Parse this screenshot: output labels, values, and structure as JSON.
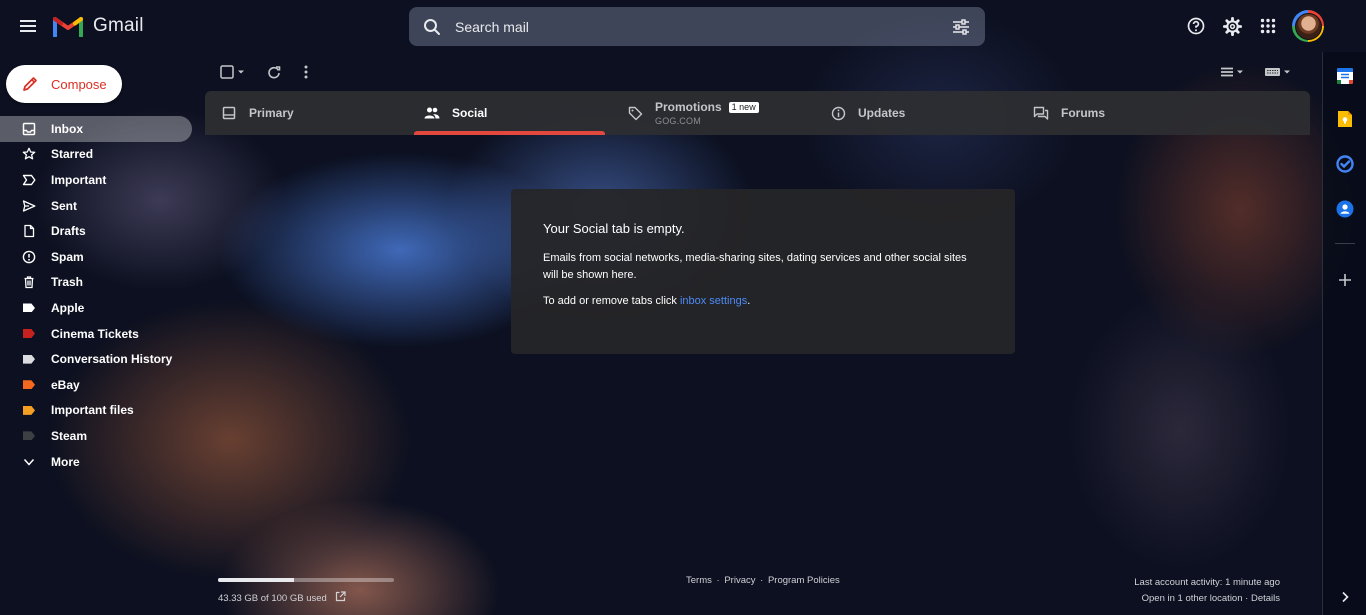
{
  "app": {
    "name": "Gmail"
  },
  "search": {
    "placeholder": "Search mail"
  },
  "compose": {
    "label": "Compose"
  },
  "sidebar": {
    "items": [
      {
        "label": "Inbox",
        "icon": "inbox-icon",
        "active": true
      },
      {
        "label": "Starred",
        "icon": "star-icon"
      },
      {
        "label": "Important",
        "icon": "important-icon"
      },
      {
        "label": "Sent",
        "icon": "send-icon"
      },
      {
        "label": "Drafts",
        "icon": "draft-icon"
      },
      {
        "label": "Spam",
        "icon": "spam-icon"
      },
      {
        "label": "Trash",
        "icon": "trash-icon"
      },
      {
        "label": "Apple",
        "icon": "label-icon",
        "color": "#ffffff"
      },
      {
        "label": "Cinema Tickets",
        "icon": "label-icon",
        "color": "#c5221f"
      },
      {
        "label": "Conversation History",
        "icon": "label-icon",
        "color": "#dadce0"
      },
      {
        "label": "eBay",
        "icon": "label-icon",
        "color": "#f5691f"
      },
      {
        "label": "Important files",
        "icon": "label-icon",
        "color": "#f59e24"
      },
      {
        "label": "Steam",
        "icon": "label-icon",
        "color": "#3c4043"
      },
      {
        "label": "More",
        "icon": "chevron-down-icon"
      }
    ]
  },
  "tabs": {
    "primary": {
      "label": "Primary"
    },
    "social": {
      "label": "Social",
      "active": true
    },
    "promotions": {
      "label": "Promotions",
      "badge": "1 new",
      "subtitle": "GOG.COM"
    },
    "updates": {
      "label": "Updates"
    },
    "forums": {
      "label": "Forums"
    }
  },
  "empty_state": {
    "title": "Your Social tab is empty.",
    "body": "Emails from social networks, media-sharing sites, dating services and other social sites will be shown here.",
    "hint_prefix": "To add or remove tabs click ",
    "hint_link": "inbox settings",
    "hint_suffix": "."
  },
  "storage": {
    "text": "43.33 GB of 100 GB used",
    "used_fraction": 0.4333
  },
  "footer": {
    "terms": "Terms",
    "privacy": "Privacy",
    "policies": "Program Policies",
    "separator": "·",
    "last_activity": "Last account activity: 1 minute ago",
    "open_in_prefix": "Open in 1 other location · ",
    "details": "Details"
  },
  "colors": {
    "accent_tab": "#e2483d",
    "link": "#4d8bf5",
    "compose_text": "#d93025"
  }
}
